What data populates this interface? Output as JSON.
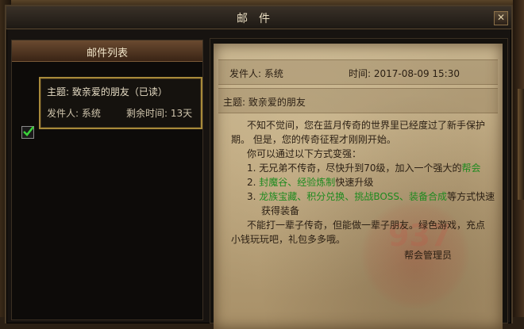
{
  "window": {
    "title": "邮件",
    "close_label": "✕"
  },
  "list": {
    "header": "邮件列表",
    "items": [
      {
        "subject": "主题: 致亲爱的朋友（已读）",
        "sender": "发件人: 系统",
        "remaining": "剩余时间: 13天",
        "checked": true
      }
    ]
  },
  "letter": {
    "sender": "发件人: 系统",
    "time": "时间: 2017-08-09 15:30",
    "subject": "主题: 致亲爱的朋友",
    "lines": {
      "l1": "不知不觉间，您在蓝月传奇的世界里已经度过了新手保护",
      "l2": "期。 但是，您的传奇征程才刚刚开始。",
      "l3": "你可以通过以下方式变强：",
      "l4a": "1. 无兄弟不传奇，尽快升到70级，加入一个强大的",
      "l4b": "帮会",
      "l5a": "2. ",
      "l5b": "封魔谷",
      "l5c": "、",
      "l5d": "经验炼制",
      "l5e": "快速升级",
      "l6a": "3. ",
      "l6b": "龙族宝藏",
      "l6c": "、",
      "l6d": "积分兑换",
      "l6e": "、",
      "l6f": "挑战BOSS",
      "l6g": "、",
      "l6h": "装备合成",
      "l6i": "等方式快速",
      "l7": "获得装备",
      "l8": "不能打一辈子传奇，但能做一辈子朋友。绿色游戏，充点",
      "l9": "小钱玩玩吧，礼包多多哦。",
      "signature": "帮会管理员"
    }
  },
  "watermark": {
    "text": "937"
  },
  "colors": {
    "highlight_green": "#1f8a1f",
    "item_border": "#a88a3a",
    "header_bg": "#6a4a30"
  },
  "icons": {
    "checkbox": "check-icon",
    "close": "close-icon"
  }
}
